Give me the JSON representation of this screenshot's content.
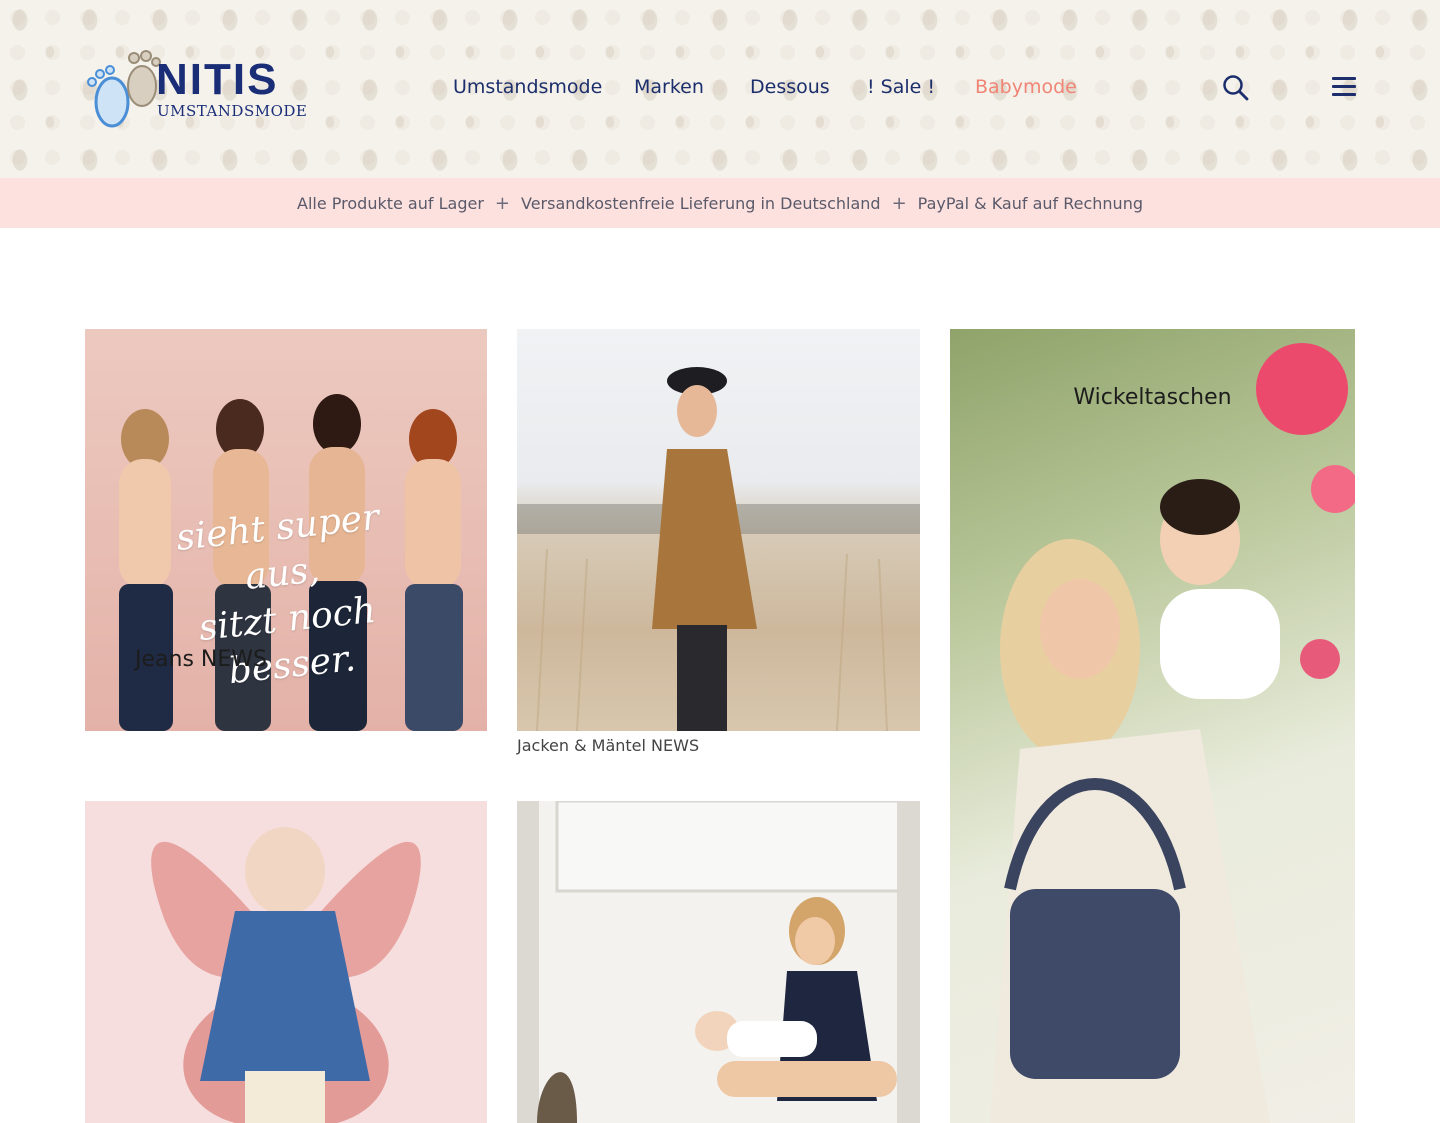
{
  "header": {
    "logo": {
      "brand": "NITIS",
      "sub": "UMSTANDSMODE"
    },
    "nav": [
      "Umstandsmode",
      "Marken",
      "Dessous",
      "! Sale !",
      "Babymode"
    ],
    "search_icon": "search-icon",
    "menu_icon": "hamburger-menu-icon"
  },
  "infobar": {
    "items": [
      "Alle Produkte auf Lager",
      "Versandkostenfreie Lieferung in Deutschland",
      "PayPal & Kauf auf Rechnung"
    ],
    "separator": "+"
  },
  "tiles": {
    "jeans": {
      "label": "Jeans NEWS",
      "overlay_line1": "sieht super aus,",
      "overlay_line2": "sitzt noch besser."
    },
    "jackets": {
      "caption": "Jacken & Mäntel NEWS"
    },
    "bags": {
      "label": "Wickeltaschen"
    }
  },
  "colors": {
    "navy": "#1c2f6c",
    "accent": "#f08575",
    "infobar": "#fde1df"
  }
}
